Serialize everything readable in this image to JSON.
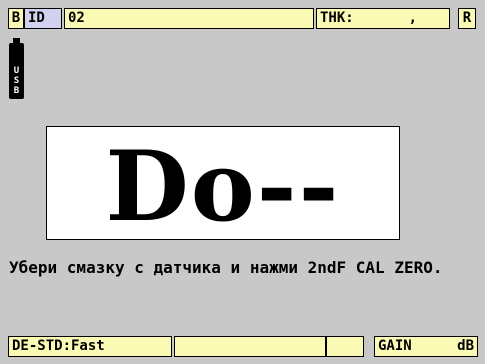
{
  "topbar": {
    "b_icon": "B",
    "id_label": "ID",
    "id_value": "02",
    "thk_label": "THK:",
    "thk_value": ",",
    "r_icon": "R"
  },
  "usb": {
    "letters": [
      "U",
      "S",
      "B"
    ]
  },
  "reading": {
    "value": "Do--"
  },
  "message": {
    "text": "Убери смазку с датчика и нажми 2ndF CAL ZERO."
  },
  "bottombar": {
    "mode": "DE-STD:Fast",
    "gain_label": "GAIN",
    "gain_unit": "dB"
  },
  "colors": {
    "background": "#c8c8c8",
    "cell": "#fafab4",
    "id_cell": "#d2d2f0"
  }
}
